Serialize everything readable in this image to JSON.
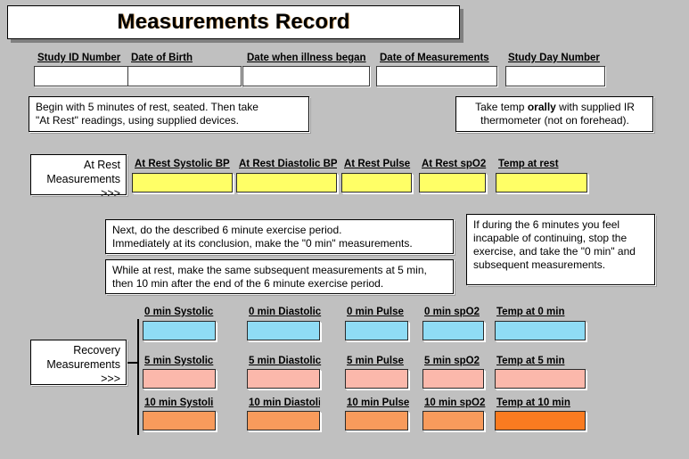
{
  "header": {
    "title": "Measurements Record"
  },
  "identity_fields": [
    {
      "label": "Study ID Number",
      "value": "",
      "placeholder": ""
    },
    {
      "label": "Date of Birth",
      "value": "",
      "placeholder": ""
    },
    {
      "label": "Date when illness began",
      "value": "",
      "placeholder": ""
    },
    {
      "label": "Date of Measurements",
      "value": "",
      "placeholder": ""
    },
    {
      "label": "Study Day Number",
      "value": "",
      "placeholder": ""
    }
  ],
  "notes": {
    "rest_instruction_line1": "Begin with 5 minutes of rest, seated. Then take",
    "rest_instruction_line2": "\"At Rest\" readings, using supplied devices.",
    "temp_instruction_pre": "Take temp ",
    "temp_instruction_bold": "orally",
    "temp_instruction_post": " with supplied IR",
    "temp_instruction_line2": "thermometer (not on forehead).",
    "exercise_line1": "Next, do the described 6 minute exercise period.",
    "exercise_line2": "Immediately at its conclusion, make the \"0 min\" measurements.",
    "subsequent_line1": "While at rest, make the same subsequent measurements at 5 min,",
    "subsequent_line2": "then 10 min after the end of the 6 minute exercise period.",
    "stop_line1": "If during the 6 minutes you feel",
    "stop_line2": "incapable of continuing, stop the",
    "stop_line3": "exercise, and take the \"0 min\" and",
    "stop_line4": "subsequent measurements."
  },
  "at_rest": {
    "callout_line1": "At Rest",
    "callout_line2": "Measurements",
    "callout_line3": ">>>",
    "fill_color": "#ffff66",
    "fields": [
      {
        "label": "At Rest Systolic BP",
        "value": ""
      },
      {
        "label": "At Rest Diastolic BP",
        "value": ""
      },
      {
        "label": "At Rest Pulse",
        "value": ""
      },
      {
        "label": "At Rest spO2",
        "value": ""
      },
      {
        "label": "Temp at rest",
        "value": ""
      }
    ]
  },
  "recovery": {
    "callout_line1": "Recovery",
    "callout_line2": "Measurements",
    "callout_line3": ">>>",
    "rows": [
      {
        "time": "0 min",
        "fill_color": "#8fdcf5",
        "temp_fill_color": "#8fdcf5",
        "fields": [
          {
            "label": "0 min Systolic",
            "value": ""
          },
          {
            "label": "0 min Diastolic",
            "value": ""
          },
          {
            "label": "0 min Pulse",
            "value": ""
          },
          {
            "label": "0 min spO2",
            "value": ""
          },
          {
            "label": "Temp at 0 min",
            "value": ""
          }
        ]
      },
      {
        "time": "5 min",
        "fill_color": "#fbb8ab",
        "temp_fill_color": "#fbb8ab",
        "fields": [
          {
            "label": "5 min Systolic",
            "value": ""
          },
          {
            "label": "5 min Diastolic",
            "value": ""
          },
          {
            "label": "5 min Pulse",
            "value": ""
          },
          {
            "label": "5 min spO2",
            "value": ""
          },
          {
            "label": "Temp at 5 min",
            "value": ""
          }
        ]
      },
      {
        "time": "10 min",
        "fill_color": "#f89b5c",
        "temp_fill_color": "#fa7b20",
        "fields": [
          {
            "label": "10 min Systoli",
            "value": ""
          },
          {
            "label": "10 min Diastoli",
            "value": ""
          },
          {
            "label": "10 min Pulse",
            "value": ""
          },
          {
            "label": "10 min spO2",
            "value": ""
          },
          {
            "label": "Temp at 10 min",
            "value": ""
          }
        ]
      }
    ]
  },
  "colors": {
    "page_background": "#c0c0c0",
    "box_background": "#ffffff",
    "border": "#000000"
  }
}
